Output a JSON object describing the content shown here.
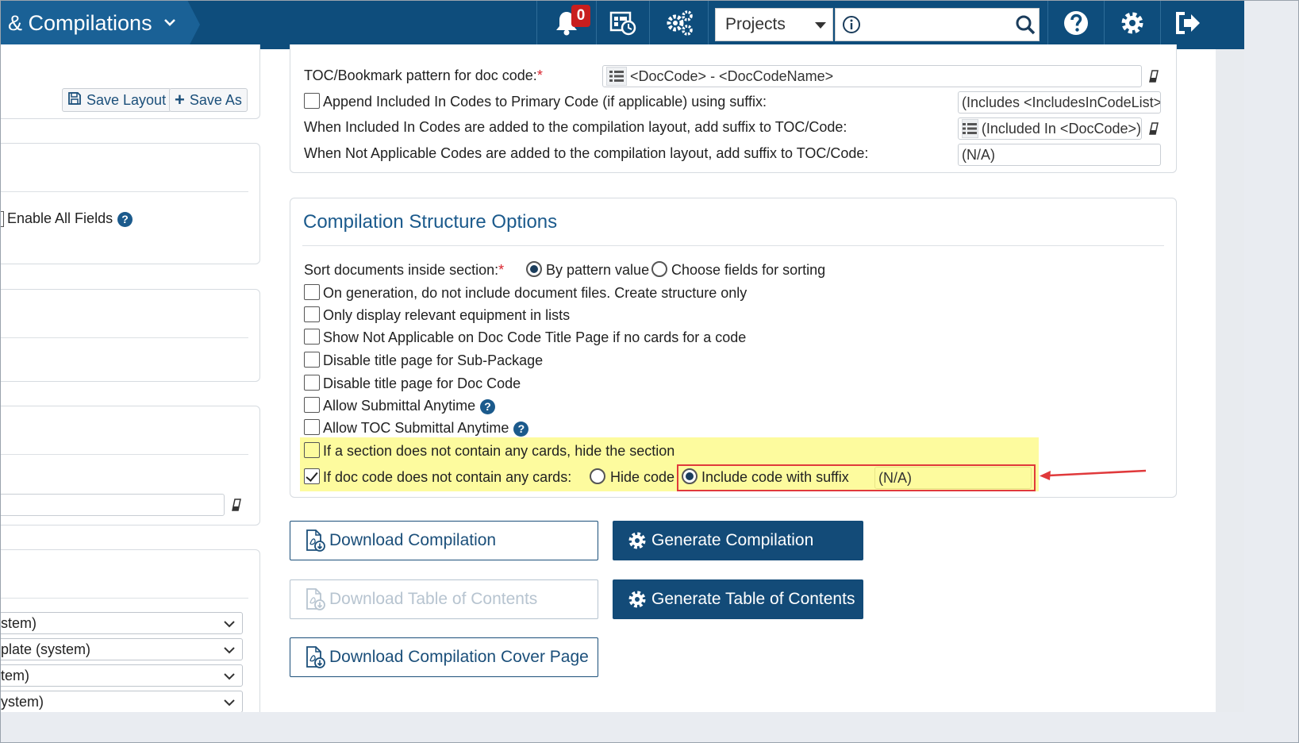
{
  "header": {
    "title": "& Compilations",
    "notification_count": "0",
    "projects_label": "Projects"
  },
  "left_panel": {
    "save_layout": "Save Layout",
    "save_as": "Save As",
    "enable_all_fields": "Enable All Fields",
    "selects": [
      "stem)",
      "plate (system)",
      "tem)",
      "ystem)"
    ]
  },
  "toc_options": {
    "toc_pattern_label": "TOC/Bookmark pattern for doc code:",
    "toc_pattern_value": "<DocCode> - <DocCodeName>",
    "append_included_label": "Append Included In Codes to Primary Code (if applicable) using suffix:",
    "append_included_value": "(Includes <IncludesInCodeList>)",
    "included_in_label": "When Included In Codes are added to the compilation layout, add suffix to TOC/Code:",
    "included_in_value": "(Included In <DocCode>)",
    "not_applicable_label": "When Not Applicable Codes are added to the compilation layout, add suffix to TOC/Code:",
    "not_applicable_value": "(N/A)"
  },
  "structure_options": {
    "title": "Compilation Structure Options",
    "sort_label": "Sort documents inside section:",
    "sort_by_pattern": "By pattern value",
    "sort_choose_fields": "Choose fields for sorting",
    "checkboxes": [
      "On generation, do not include document files. Create structure only",
      "Only display relevant equipment in lists",
      "Show Not Applicable on Doc Code Title Page if no cards for a code",
      "Disable title page for Sub-Package",
      "Disable title page for Doc Code",
      "Allow Submittal Anytime",
      "Allow TOC Submittal Anytime",
      "If a section does not contain any cards, hide the section",
      "If doc code does not contain any cards:"
    ],
    "hide_code": "Hide code",
    "include_code_suffix": "Include code with suffix",
    "suffix_value": "(N/A)"
  },
  "actions": {
    "download_compilation": "Download Compilation",
    "generate_compilation": "Generate Compilation",
    "download_toc": "Download Table of Contents",
    "generate_toc": "Generate Table of Contents",
    "download_cover": "Download Compilation Cover Page"
  },
  "colors": {
    "topbar": "#0e4d7c",
    "accent": "#1b5a8c",
    "highlight": "#fdfb9e",
    "annotation_red": "#e0393b"
  }
}
